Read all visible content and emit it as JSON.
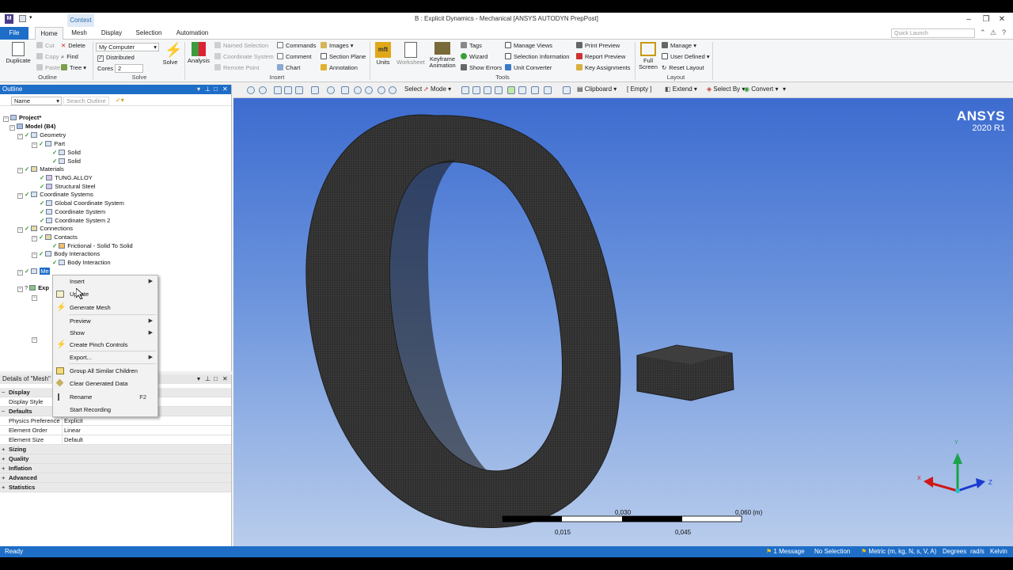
{
  "window": {
    "title": "B : Explicit Dynamics - Mechanical [ANSYS AUTODYN PrepPost]",
    "context_tab": "Context",
    "app_icon": "M"
  },
  "ribbon_tabs": [
    "File",
    "Home",
    "Mesh",
    "Display",
    "Selection",
    "Automation"
  ],
  "quick_launch": {
    "placeholder": "Quick Launch"
  },
  "ribbon": {
    "outline": {
      "duplicate": "Duplicate",
      "cut": "Cut",
      "copy": "Copy",
      "paste": "Paste",
      "delete": "Delete",
      "find": "Find",
      "tree": "Tree",
      "label": "Outline"
    },
    "solve": {
      "computer": "My Computer",
      "distributed": "Distributed",
      "cores_label": "Cores",
      "cores_value": "2",
      "solve": "Solve",
      "label": "Solve"
    },
    "insert": {
      "analysis": "Analysis",
      "named_selection": "Named Selection",
      "coordinate_system": "Coordinate System",
      "remote_point": "Remote Point",
      "commands": "Commands",
      "comment": "Comment",
      "chart": "Chart",
      "images": "Images",
      "section_plane": "Section Plane",
      "annotation": "Annotation",
      "label": "Insert"
    },
    "tools": {
      "units": "Units",
      "worksheet": "Worksheet",
      "keyframe_animation": "Keyframe Animation",
      "tags": "Tags",
      "wizard": "Wizard",
      "show_errors": "Show Errors",
      "manage_views": "Manage Views",
      "selection_information": "Selection Information",
      "unit_converter": "Unit Converter",
      "print_preview": "Print Preview",
      "report_preview": "Report Preview",
      "key_assignments": "Key Assignments",
      "label": "Tools"
    },
    "layout": {
      "full_screen": "Full Screen",
      "manage": "Manage",
      "user_defined": "User Defined",
      "reset_layout": "Reset Layout",
      "label": "Layout"
    }
  },
  "graphics_toolbar": {
    "select": "Select",
    "mode": "Mode",
    "clipboard": "Clipboard",
    "empty": "[ Empty ]",
    "extend": "Extend",
    "select_by": "Select By",
    "convert": "Convert"
  },
  "outline": {
    "title": "Outline",
    "name_filter": "Name",
    "search_placeholder": "Search Outline",
    "tree": [
      "Project*",
      "Model (B4)",
      "Geometry",
      "Part",
      "Solid",
      "Solid",
      "Materials",
      "TUNG.ALLOY",
      "Structural Steel",
      "Coordinate Systems",
      "Global Coordinate System",
      "Coordinate System",
      "Coordinate System 2",
      "Connections",
      "Contacts",
      "Frictional - Solid To Solid",
      "Body Interactions",
      "Body Interaction",
      "Me",
      "Exp"
    ]
  },
  "context_menu": {
    "items": [
      "Insert",
      "Update",
      "Generate Mesh",
      "Preview",
      "Show",
      "Create Pinch Controls",
      "Export...",
      "Group All Similar Children",
      "Clear Generated Data",
      "Rename",
      "Start Recording"
    ],
    "rename_shortcut": "F2"
  },
  "details": {
    "title": "Details of \"Mesh\"",
    "rows": [
      {
        "key": "Display",
        "value": "",
        "category": true
      },
      {
        "key": "Display Style",
        "value": "",
        "category": false
      },
      {
        "key": "Defaults",
        "value": "",
        "category": true
      },
      {
        "key": "Physics Preference",
        "value": "Explicit",
        "category": false
      },
      {
        "key": "Element Order",
        "value": "Linear",
        "category": false
      },
      {
        "key": "Element Size",
        "value": "Default",
        "category": false
      },
      {
        "key": "Sizing",
        "value": "",
        "category": true
      },
      {
        "key": "Quality",
        "value": "",
        "category": true
      },
      {
        "key": "Inflation",
        "value": "",
        "category": true
      },
      {
        "key": "Advanced",
        "value": "",
        "category": true
      },
      {
        "key": "Statistics",
        "value": "",
        "category": true
      }
    ]
  },
  "viewport": {
    "logo": "ANSYS",
    "version": "2020 R1",
    "scale_top": [
      "0,030",
      "0,060 (m)"
    ],
    "scale_bottom": [
      "0,015",
      "0,045"
    ],
    "triad": {
      "x": "X",
      "y": "Y",
      "z": "Z"
    }
  },
  "status_bar": {
    "ready": "Ready",
    "messages": "1 Message",
    "selection": "No Selection",
    "units": "Metric (m, kg, N, s, V, A)",
    "angle": "Degrees",
    "rate": "rad/s",
    "temperature": "Kelvin"
  },
  "colors": {
    "accent": "#1e6ec8",
    "viewport_top": "#3d6cd0",
    "viewport_bottom": "#b9cdec",
    "mesh": "#2b2b2b"
  }
}
